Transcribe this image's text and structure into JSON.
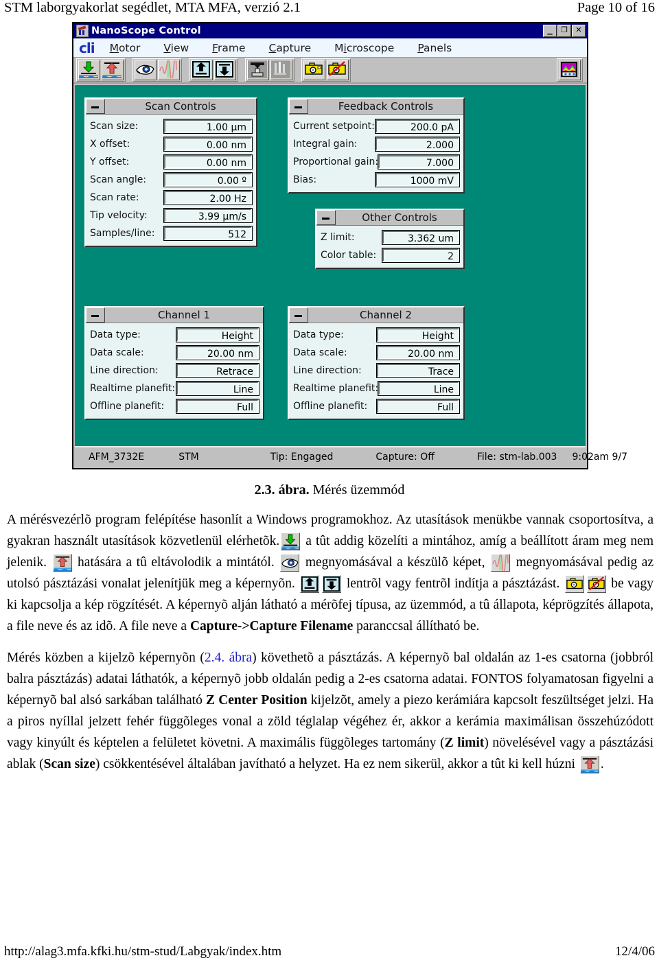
{
  "runhead": {
    "left": "STM laborgyakorlat segédlet, MTA MFA, verzió 2.1",
    "right": "Page 10 of 16"
  },
  "window": {
    "title": "NanoScope Control",
    "titlebar_buttons": {
      "minimize": "_",
      "maximize": "❐",
      "close": "✕"
    },
    "logo": "cli",
    "menus": [
      {
        "label": "Motor",
        "accel": "M"
      },
      {
        "label": "View",
        "accel": "V"
      },
      {
        "label": "Frame",
        "accel": "F"
      },
      {
        "label": "Capture",
        "accel": "C"
      },
      {
        "label": "Microscope",
        "accel": "i"
      },
      {
        "label": "Panels",
        "accel": "P"
      }
    ],
    "toolbar_groups": [
      {
        "name": "motor-group",
        "buttons": [
          {
            "icon": "tip-engage-icon",
            "tip": "Engage"
          },
          {
            "icon": "tip-withdraw-icon",
            "tip": "Withdraw"
          }
        ]
      },
      {
        "name": "view-group",
        "buttons": [
          {
            "icon": "eye-image-icon",
            "tip": "View image"
          },
          {
            "icon": "scope-trace-icon",
            "tip": "View scope trace"
          }
        ]
      },
      {
        "name": "frame-group",
        "buttons": [
          {
            "icon": "frame-up-icon",
            "tip": "Frame up"
          },
          {
            "icon": "frame-down-icon",
            "tip": "Frame down"
          }
        ]
      },
      {
        "name": "microscope-group",
        "buttons": [
          {
            "icon": "scanner-head-icon",
            "tip": "Microscope select"
          },
          {
            "icon": "tip-holder-icon",
            "tip": "Tip"
          }
        ]
      },
      {
        "name": "capture-group",
        "buttons": [
          {
            "icon": "camera-capture-on-icon",
            "tip": "Capture"
          },
          {
            "icon": "camera-capture-off-icon",
            "tip": "Capture cancel"
          }
        ]
      },
      {
        "name": "panels-group",
        "buttons": [
          {
            "icon": "color-chart-icon",
            "tip": "Panels"
          }
        ]
      }
    ],
    "panels": [
      {
        "id": "scan",
        "title": "Scan Controls",
        "rows": [
          {
            "label": "Scan size:",
            "value": "1.00 µm"
          },
          {
            "label": "X offset:",
            "value": "0.00 nm"
          },
          {
            "label": "Y offset:",
            "value": "0.00 nm"
          },
          {
            "label": "Scan angle:",
            "value": "0.00 º"
          },
          {
            "label": "Scan rate:",
            "value": "2.00 Hz"
          },
          {
            "label": "Tip velocity:",
            "value": "3.99 µm/s"
          },
          {
            "label": "Samples/line:",
            "value": "512"
          }
        ]
      },
      {
        "id": "feedback",
        "title": "Feedback Controls",
        "rows": [
          {
            "label": "Current setpoint:",
            "value": "200.0 pA"
          },
          {
            "label": "Integral gain:",
            "value": "2.000"
          },
          {
            "label": "Proportional gain:",
            "value": "7.000"
          },
          {
            "label": "Bias:",
            "value": "1000 mV"
          }
        ]
      },
      {
        "id": "other",
        "title": "Other Controls",
        "rows": [
          {
            "label": "Z limit:",
            "value": "3.362 um"
          },
          {
            "label": "Color table:",
            "value": "2"
          }
        ]
      },
      {
        "id": "ch1",
        "title": "Channel 1",
        "rows": [
          {
            "label": "Data type:",
            "value": "Height"
          },
          {
            "label": "Data scale:",
            "value": "20.00 nm"
          },
          {
            "label": "Line direction:",
            "value": "Retrace"
          },
          {
            "label": "Realtime planefit:",
            "value": "Line"
          },
          {
            "label": "Offline planefit:",
            "value": "Full"
          }
        ]
      },
      {
        "id": "ch2",
        "title": "Channel 2",
        "rows": [
          {
            "label": "Data type:",
            "value": "Height"
          },
          {
            "label": "Data scale:",
            "value": "20.00 nm"
          },
          {
            "label": "Line direction:",
            "value": "Trace"
          },
          {
            "label": "Realtime planefit:",
            "value": "Line"
          },
          {
            "label": "Offline planefit:",
            "value": "Full"
          }
        ]
      }
    ],
    "statusbar": {
      "head": "AFM_3732E",
      "mode": "STM",
      "tip": "Tip: Engaged",
      "capture": "Capture: Off",
      "file": "File: stm-lab.003",
      "time": "9:02am 9/7"
    }
  },
  "figure": {
    "number": "2.3. ábra.",
    "caption": "Mérés üzemmód"
  },
  "body": {
    "p1_a": "A mérésvezérlõ program felépítése hasonlít a Windows programokhoz. Az utasítások menükbe vannak csoportosítva, a gyakran használt utasítások közvetlenül elérhetõk.",
    "p1_b": "a tût addig közelíti a mintához, amíg a beállított áram meg nem jelenik.",
    "p1_c": "hatására a tû eltávolodik a mintától.",
    "p1_d": "megnyomásával a készülõ képet,",
    "p1_e": "megnyomásával pedig az utolsó pásztázási vonalat jelenítjük meg a képernyõn.",
    "p1_f": "lentrõl vagy fentrõl indítja a pásztázást.",
    "p1_g": "be vagy ki kapcsolja a kép rögzítését. A képernyõ alján látható a mérõfej típusa, az üzemmód, a tû állapota, képrögzítés állapota, a file neve és az idõ. A file neve a",
    "p1_h": "Capture->Capture Filename",
    "p1_i": "paranccsal állítható be.",
    "p2_a": "Mérés közben a kijelzõ képernyõn (",
    "p2_link": "2.4. ábra",
    "p2_b": ") követhetõ a pásztázás. A képernyõ bal oldalán az 1-es csatorna (jobbról balra pásztázás) adatai láthatók, a képernyõ jobb oldalán pedig a 2-es csatorna adatai. FONTOS folyamatosan figyelni a képernyõ bal alsó sarkában található",
    "p2_bold1": "Z Center Position",
    "p2_c": "kijelzõt, amely a piezo kerámiára kapcsolt feszültséget jelzi. Ha a piros nyíllal jelzett fehér függõleges vonal a zöld téglalap végéhez ér, akkor a kerámia maximálisan összehúzódott vagy kinyúlt és képtelen a felületet követni. A maximális függõleges tartomány (",
    "p2_bold2": "Z limit",
    "p2_d": ") növelésével vagy a pásztázási ablak (",
    "p2_bold3": "Scan size",
    "p2_e": ") csökkentésével általában javítható a helyzet. Ha ez nem sikerül, akkor a tût ki kell húzni",
    "p2_f": "."
  },
  "footer": {
    "url": "http://alag3.mfa.kfki.hu/stm-stud/Labgyak/index.htm",
    "date": "12/4/06"
  },
  "colors": {
    "desktop_teal": "#008877",
    "titlebar_blue": "#000080",
    "panel_bg": "#e8f4f4",
    "chrome_gray": "#c0c0c0",
    "link_blue": "#2222cc"
  }
}
